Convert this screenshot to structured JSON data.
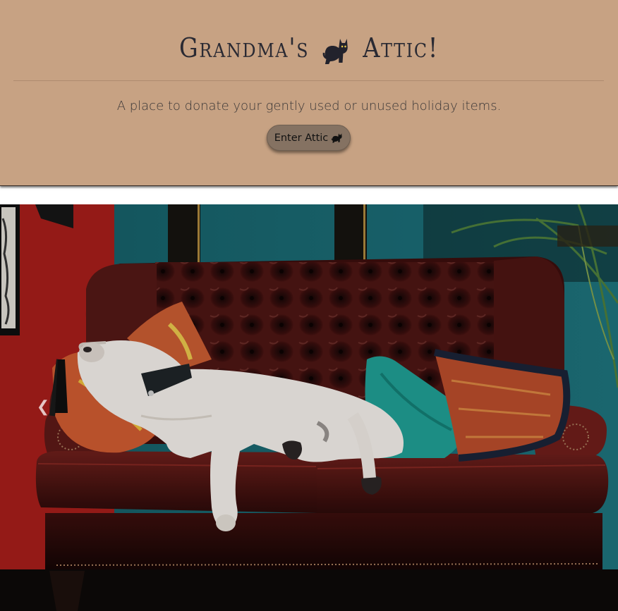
{
  "header": {
    "title_before": "Grandma's",
    "title_after": "Attic!",
    "title_icon": "cat-icon",
    "tagline": "A place to donate your gently used or unused holiday items.",
    "enter_button_label": "Enter Attic",
    "enter_button_icon": "cat-icon"
  },
  "carousel": {
    "prev_icon": "chevron-left-icon",
    "slide_image": "photo-bulldog-on-leather-sofa"
  },
  "colors": {
    "header_bg": "#c7a283",
    "button_bg": "#857262",
    "text_dark": "#2a2a33"
  }
}
